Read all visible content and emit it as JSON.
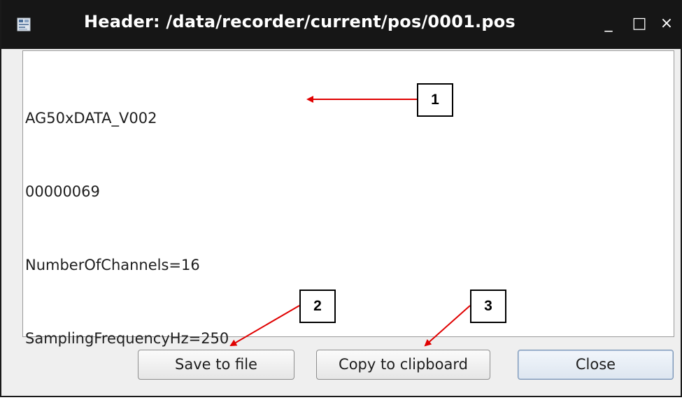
{
  "window": {
    "title": "Header: /data/recorder/current/pos/0001.pos",
    "controls": {
      "minimize_glyph": "_",
      "maximize_glyph": "□",
      "close_glyph": "×"
    },
    "app_icon": "window-app-icon"
  },
  "header_text": {
    "lines": [
      "AG50xDATA_V002",
      "00000069",
      "NumberOfChannels=16",
      "SamplingFrequencyHz=250"
    ]
  },
  "buttons": {
    "save_label": "Save to file",
    "copy_label": "Copy to clipboard",
    "close_label": "Close"
  },
  "annotations": {
    "callouts": [
      "1",
      "2",
      "3"
    ],
    "arrow_color": "#e00000"
  },
  "colors": {
    "titlebar": "#161616",
    "dialog_background": "#efefef",
    "text_area_background": "#ffffff",
    "default_button_border": "#7a94b5"
  }
}
